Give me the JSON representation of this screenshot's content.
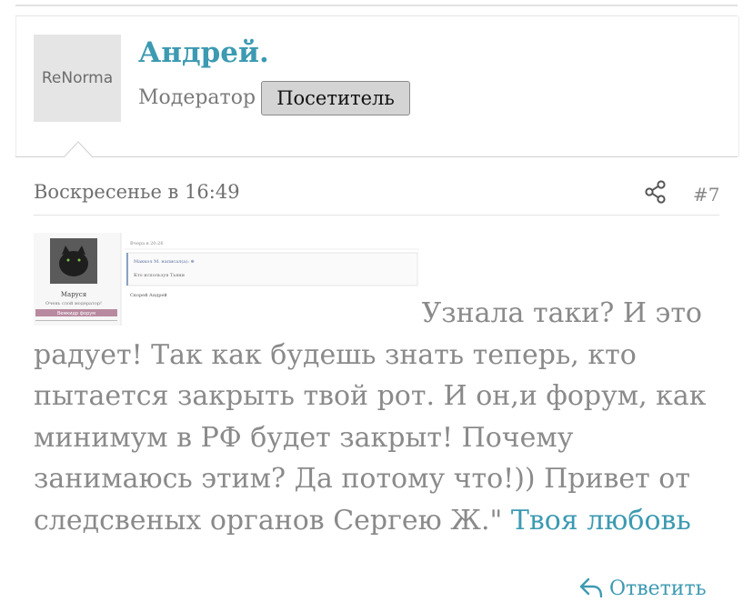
{
  "user": {
    "avatar_label": "ReNorma",
    "name": "Андрей.",
    "role": "Модератор",
    "badge": "Посетитель"
  },
  "post": {
    "date": "Воскресенье в 16:49",
    "number": "#7",
    "text_line1": "Узнала таки? И это",
    "text_rest": "радует! Так как будешь знать теперь, кто пытается закрыть твой рот. И он,и форум, как минимум в РФ будет закрыт! Почему занимаюсь этим? Да потому что!)) Привет от следсвеных органов Сергею Ж.\" ",
    "link_text": "Твоя любовь",
    "reply_label": "Ответить"
  },
  "embedded_screenshot": {
    "profile_name": "Маруся",
    "profile_subtitle": "Очень слой модератор!",
    "profile_button": "Вемкидр форум",
    "header_text": "Вчера в 20:26",
    "quote_author": "Маккол М. написал(а): ⊕",
    "quote_text": "Кто используя Тьяни",
    "reply_text": "Скорей Андрей"
  },
  "colors": {
    "accent": "#3c9ab2",
    "text_muted": "#8a8a8a",
    "badge_bg": "#d4d4d4",
    "embedded_button": "#b88aa0"
  },
  "icons": {
    "share": "share-icon",
    "reply": "reply-arrow-icon",
    "pointer": "speech-pointer"
  }
}
